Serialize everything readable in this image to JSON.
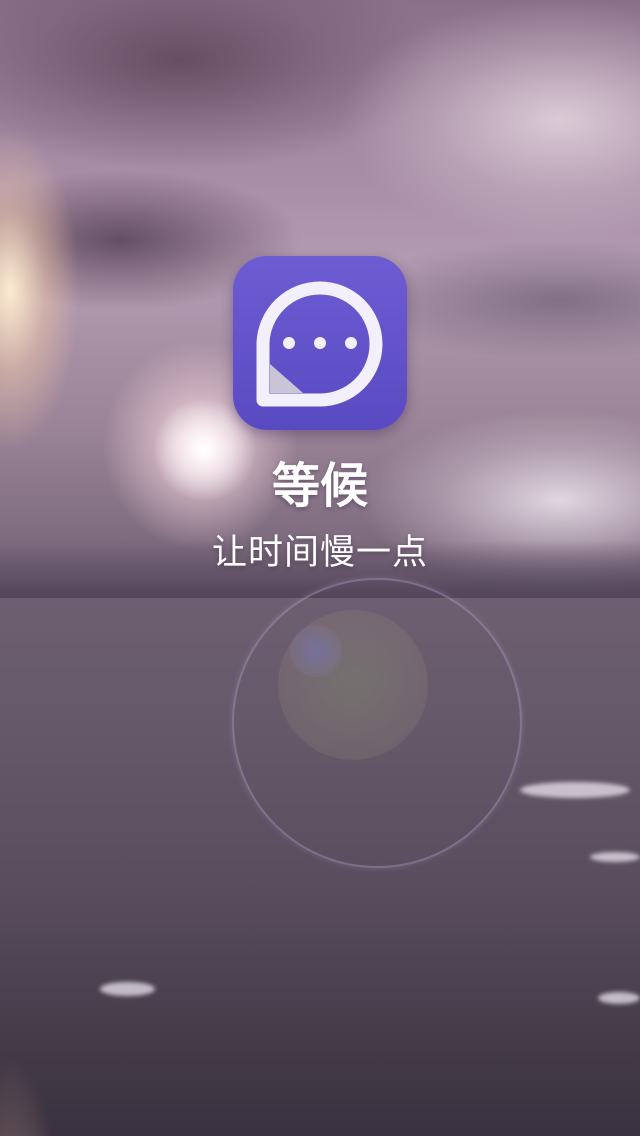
{
  "splash": {
    "app_name": "等候",
    "slogan": "让时间慢一点",
    "icon": "chat-bubble-ellipsis-icon",
    "background": "stormy-sunset-sea-photo"
  },
  "colors": {
    "icon_gradient_top": "#6d5cd2",
    "icon_gradient_bottom": "#5a4ac2",
    "text": "#ffffff"
  }
}
